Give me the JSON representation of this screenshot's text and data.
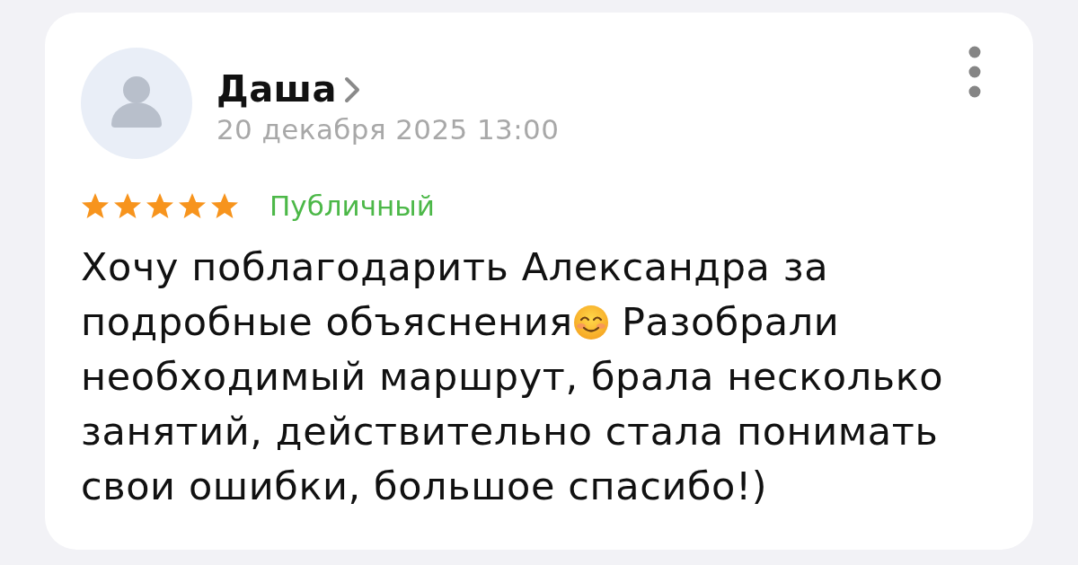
{
  "review": {
    "author": "Даша",
    "date": "20 декабря 2025 13:00",
    "stars": 5,
    "visibility": "Публичный",
    "body": [
      {
        "kind": "text",
        "text": "Хочу поблагодарить Александра за подробные объяснения"
      },
      {
        "kind": "emoji"
      },
      {
        "kind": "text",
        "text": " Разобрали необходимый маршрут, брала несколько занятий, действительно стала понимать свои ошибки, большое спасибо!)"
      }
    ]
  }
}
